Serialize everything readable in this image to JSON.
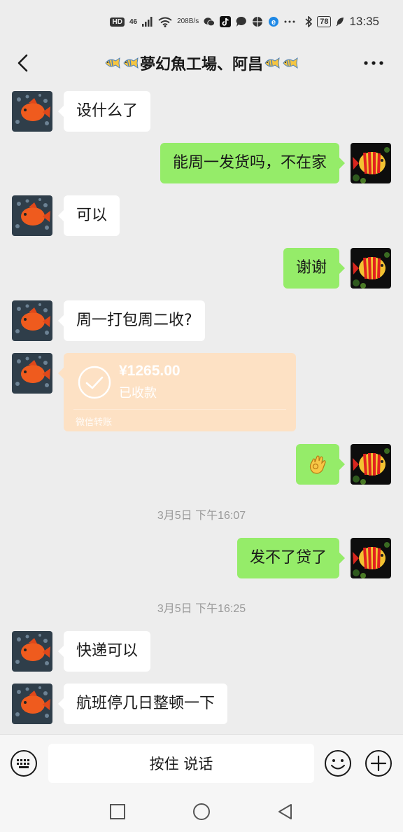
{
  "status_bar": {
    "hd": "HD",
    "signal": "46",
    "speed_value": "208",
    "speed_unit": "B/s",
    "battery": "78",
    "time": "13:35",
    "icons": [
      "signal-icon",
      "wifi-icon",
      "wechat-icon",
      "tiktok-icon",
      "chat-icon",
      "app-icon",
      "browser-icon",
      "more-dots-icon",
      "bluetooth-icon",
      "battery-icon",
      "leaf-icon"
    ]
  },
  "header": {
    "title": "夢幻魚工場、阿昌",
    "back_icon": "chevron-left-icon",
    "more_icon": "more-horizontal-icon"
  },
  "messages": [
    {
      "side": "in",
      "type": "text",
      "text": "设什么了"
    },
    {
      "side": "out",
      "type": "text",
      "text": "能周一发货吗，不在家"
    },
    {
      "side": "in",
      "type": "text",
      "text": "可以"
    },
    {
      "side": "out",
      "type": "text",
      "text": "谢谢"
    },
    {
      "side": "in",
      "type": "text",
      "text": "周一打包周二收?"
    },
    {
      "side": "in",
      "type": "transfer",
      "amount": "¥1265.00",
      "status": "已收款",
      "footer": "微信转账"
    },
    {
      "side": "out",
      "type": "emoji",
      "emoji": "ok-hand-emoji"
    },
    {
      "type": "time",
      "text": "3月5日 下午16:07"
    },
    {
      "side": "out",
      "type": "text",
      "text": "发不了贷了"
    },
    {
      "type": "time",
      "text": "3月5日 下午16:25"
    },
    {
      "side": "in",
      "type": "text",
      "text": "快递可以"
    },
    {
      "side": "in",
      "type": "text",
      "text": "航班停几日整顿一下"
    }
  ],
  "input_bar": {
    "hold_to_talk": "按住 说话",
    "voice_icon": "keyboard-icon",
    "emoji_icon": "emoji-icon",
    "plus_icon": "plus-icon"
  },
  "nav_bar": {
    "icons": [
      "recent-apps-icon",
      "home-icon",
      "back-triangle-icon"
    ]
  },
  "colors": {
    "background": "#ededed",
    "outgoing_bubble": "#95ec69",
    "incoming_bubble": "#ffffff",
    "transfer_card": "#fde1c4"
  }
}
